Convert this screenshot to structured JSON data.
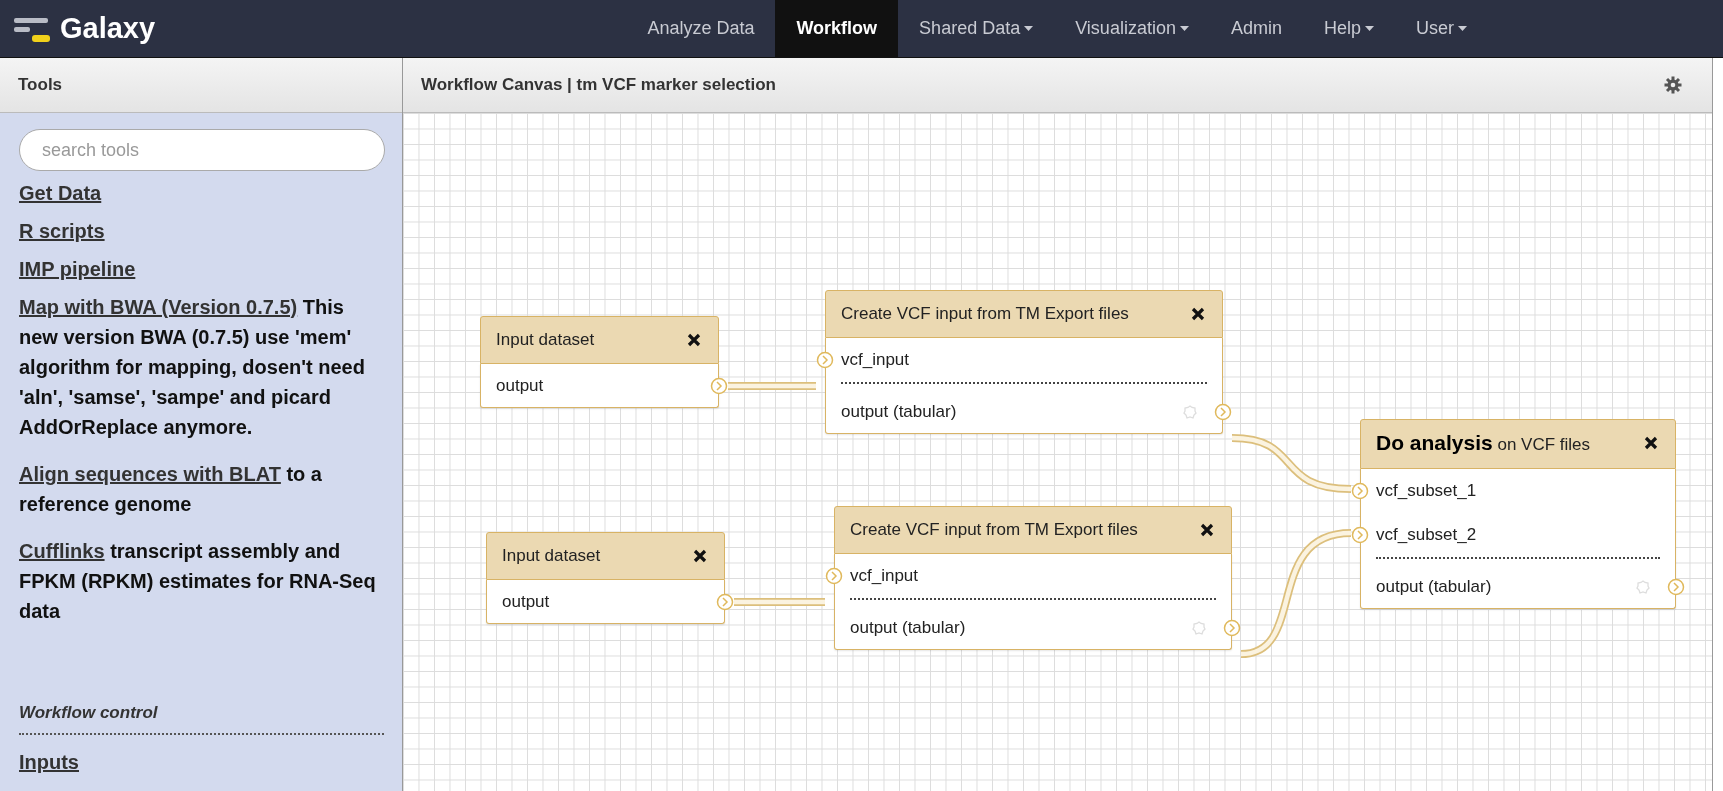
{
  "masthead": {
    "brand": "Galaxy",
    "nav": [
      {
        "label": "Analyze Data",
        "selected": false,
        "dropdown": false
      },
      {
        "label": "Workflow",
        "selected": true,
        "dropdown": false
      },
      {
        "label": "Shared Data",
        "selected": false,
        "dropdown": true
      },
      {
        "label": "Visualization",
        "selected": false,
        "dropdown": true
      },
      {
        "label": "Admin",
        "selected": false,
        "dropdown": false
      },
      {
        "label": "Help",
        "selected": false,
        "dropdown": true
      },
      {
        "label": "User",
        "selected": false,
        "dropdown": true
      }
    ]
  },
  "tool_panel": {
    "title": "Tools",
    "search": {
      "placeholder": "search tools"
    },
    "tools": [
      {
        "link": "Get Data"
      },
      {
        "link": "R scripts"
      },
      {
        "link": "IMP pipeline"
      },
      {
        "link": "Map with BWA (Version 0.7.5)",
        "description": "This new version BWA (0.7.5) use 'mem' algorithm for mapping, dosen't need 'aln', 'samse', 'sampe' and picard AddOrReplace anymore."
      },
      {
        "link": "Align sequences with BLAT",
        "description": "to a reference genome"
      },
      {
        "link": "Cufflinks",
        "description": "transcript assembly and FPKM (RPKM) estimates for RNA-Seq data"
      }
    ],
    "section": {
      "title": "Workflow control",
      "items": [
        "Inputs"
      ]
    }
  },
  "canvas": {
    "title": "Workflow Canvas | tm VCF marker selection",
    "nodes": [
      {
        "kind": "input",
        "title": "Input dataset",
        "outputs": [
          "output"
        ]
      },
      {
        "kind": "tool",
        "title": "Create VCF input from TM Export files",
        "inputs": [
          "vcf_input"
        ],
        "outputs": [
          "output (tabular)"
        ]
      },
      {
        "kind": "tool",
        "title": "**Do analysis** on VCF files",
        "inputs": [
          "vcf_subset_1",
          "vcf_subset_2"
        ],
        "outputs": [
          "output (tabular)"
        ]
      },
      {
        "kind": "input",
        "title": "Input dataset",
        "outputs": [
          "output"
        ]
      },
      {
        "kind": "tool",
        "title": "Create VCF input from TM Export files",
        "inputs": [
          "vcf_input"
        ],
        "outputs": [
          "output (tabular)"
        ]
      }
    ]
  }
}
